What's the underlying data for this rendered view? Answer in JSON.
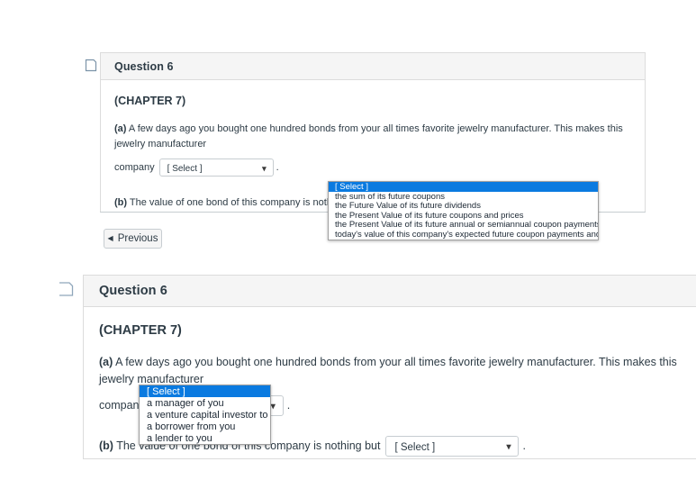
{
  "panel1": {
    "bookmark_icon": "bookmark-outline-icon",
    "header_title": "Question 6",
    "chapter": "(CHAPTER 7)",
    "part_a": {
      "label": "(a)",
      "text": "A few days ago you bought one hundred bonds from your all times favorite jewelry manufacturer. This makes this jewelry manufacturer",
      "lead_in": "company",
      "trailing": ".",
      "select": {
        "name": "select-a",
        "value": "[ Select ]",
        "caret_icon": "chevron-down-icon"
      }
    },
    "part_b": {
      "label": "(b)",
      "text": "The value of one bond of this company is nothing but",
      "trailing": ".",
      "select": {
        "name": "select-b",
        "value": "[ Select ]",
        "caret_icon": "chevron-down-icon"
      }
    },
    "dropdown": {
      "open": true,
      "belongs_to": "select-b",
      "highlight_color": "#0a7ae0",
      "options": [
        "[ Select ]",
        "the sum of its future coupons",
        "the Future Value of its future dividends",
        "the Present Value of its future coupons and prices",
        "the Present Value of its future annual or semiannual coupon payments",
        "today's value of this company's expected future coupon payments and par value"
      ],
      "selected_index": 0
    },
    "previous_button": {
      "arrow_icon": "triangle-left-icon",
      "label": "Previous"
    }
  },
  "panel2": {
    "bookmark_icon": "bookmark-outline-icon",
    "header_title": "Question 6",
    "chapter": "(CHAPTER 7)",
    "part_a": {
      "label": "(a)",
      "text": "A few days ago you bought one hundred bonds from your all times favorite jewelry manufacturer. This makes this jewelry manufacturer",
      "lead_in": "company",
      "trailing": ".",
      "select": {
        "name": "select-a",
        "value": "[ Select ]",
        "caret_icon": "chevron-down-icon"
      }
    },
    "part_b": {
      "label": "(b)",
      "text_visible_start": "The va",
      "text_visible_end": "y is nothing but",
      "text_full": "The value of one bond of this company is nothing but",
      "trailing": ".",
      "select": {
        "name": "select-b",
        "value": "[ Select ]",
        "caret_icon": "chevron-down-icon"
      }
    },
    "dropdown": {
      "open": true,
      "belongs_to": "select-a",
      "highlight_color": "#0a7ae0",
      "options": [
        "[ Select ]",
        "a manager of you",
        "a venture capital investor to",
        "a borrower from you",
        "a lender to you"
      ],
      "selected_index": 0
    }
  }
}
